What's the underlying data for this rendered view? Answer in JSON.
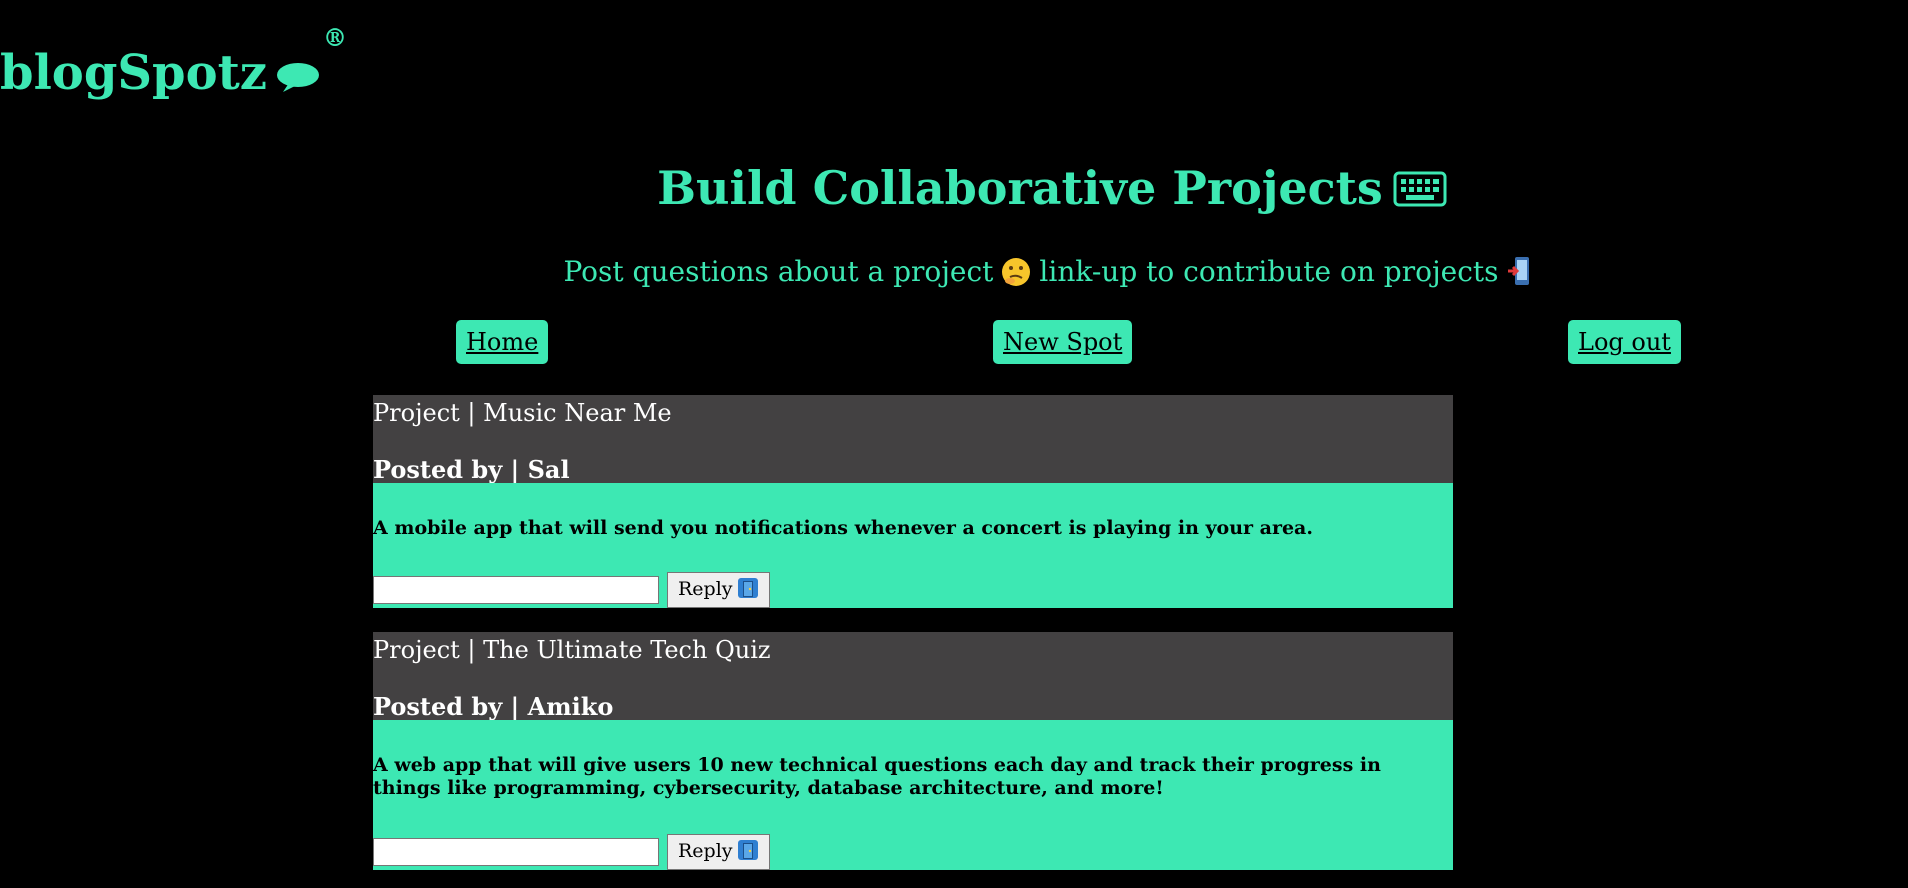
{
  "app": {
    "logo_text": "blogSpotz",
    "logo_mark": "®",
    "logo_icon": "speech-bubble-icon"
  },
  "hero": {
    "title": "Build Collaborative Projects",
    "title_icon": "keyboard-icon",
    "subtitle_part1": "Post questions about a project",
    "subtitle_icon1": "thinking-face-icon",
    "subtitle_part2": "link-up to contribute on projects",
    "subtitle_icon2": "mobile-phone-arrow-icon"
  },
  "nav": {
    "home": "Home",
    "new_spot": "New Spot",
    "logout": "Log out"
  },
  "posts": [
    {
      "title": "Project | Music Near Me",
      "author": "Posted by | Sal",
      "description": "A mobile app that will send you notifications whenever a concert is playing in your area.",
      "reply_value": "",
      "reply_label": "Reply"
    },
    {
      "title": "Project | The Ultimate Tech Quiz",
      "author": "Posted by | Amiko",
      "description": "A web app that will give users 10 new technical questions each day and track their progress in things like programming, cybersecurity, database architecture, and more!",
      "reply_value": "",
      "reply_label": "Reply"
    }
  ],
  "colors": {
    "background": "#000000",
    "accent": "#3de8b3",
    "card_header": "#434142"
  }
}
